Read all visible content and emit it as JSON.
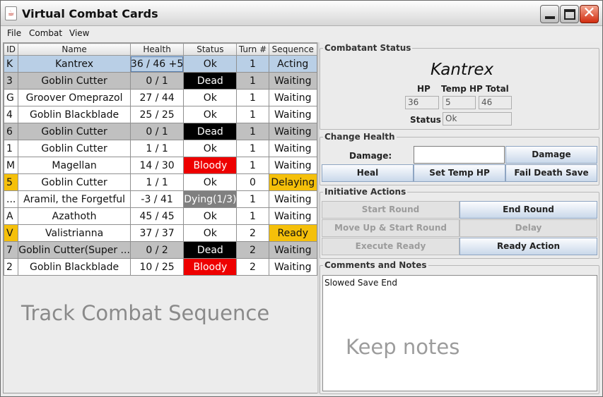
{
  "window": {
    "title": "Virtual Combat Cards"
  },
  "menu": [
    "File",
    "Combat",
    "View"
  ],
  "table": {
    "headers": {
      "id": "ID",
      "name": "Name",
      "health": "Health",
      "status": "Status",
      "turn": "Turn #",
      "sequence": "Sequence"
    },
    "rows": [
      {
        "id": "K",
        "name": "Kantrex",
        "health": "36 / 46 +5",
        "status": "Ok",
        "turn": "1",
        "sequence": "Acting"
      },
      {
        "id": "3",
        "name": "Goblin Cutter",
        "health": "0 / 1",
        "status": "Dead",
        "turn": "1",
        "sequence": "Waiting"
      },
      {
        "id": "G",
        "name": "Groover Omeprazol",
        "health": "27 / 44",
        "status": "Ok",
        "turn": "1",
        "sequence": "Waiting"
      },
      {
        "id": "4",
        "name": "Goblin Blackblade",
        "health": "25 / 25",
        "status": "Ok",
        "turn": "1",
        "sequence": "Waiting"
      },
      {
        "id": "6",
        "name": "Goblin Cutter",
        "health": "0 / 1",
        "status": "Dead",
        "turn": "1",
        "sequence": "Waiting"
      },
      {
        "id": "1",
        "name": "Goblin Cutter",
        "health": "1 / 1",
        "status": "Ok",
        "turn": "1",
        "sequence": "Waiting"
      },
      {
        "id": "M",
        "name": "Magellan",
        "health": "14 / 30",
        "status": "Bloody",
        "turn": "1",
        "sequence": "Waiting"
      },
      {
        "id": "5",
        "name": "Goblin Cutter",
        "health": "1 / 1",
        "status": "Ok",
        "turn": "0",
        "sequence": "Delaying"
      },
      {
        "id": "...",
        "name": "Aramil, the Forgetful",
        "health": "-3 / 41",
        "status": "Dying(1/3)",
        "turn": "1",
        "sequence": "Waiting"
      },
      {
        "id": "A",
        "name": "Azathoth",
        "health": "45 / 45",
        "status": "Ok",
        "turn": "1",
        "sequence": "Waiting"
      },
      {
        "id": "V",
        "name": "Valistrianna",
        "health": "37 / 37",
        "status": "Ok",
        "turn": "2",
        "sequence": "Ready"
      },
      {
        "id": "7",
        "name": "Goblin Cutter(Super ...",
        "health": "0 / 2",
        "status": "Dead",
        "turn": "2",
        "sequence": "Waiting"
      },
      {
        "id": "2",
        "name": "Goblin Blackblade",
        "health": "10 / 25",
        "status": "Bloody",
        "turn": "2",
        "sequence": "Waiting"
      }
    ]
  },
  "left_watermark": "Track Combat Sequence",
  "combatant_status": {
    "title": "Combatant Status",
    "name": "Kantrex",
    "hp_label": "HP",
    "temp_hp_label": "Temp HP",
    "total_label": "Total",
    "hp": "36",
    "temp_hp": "5",
    "total": "46",
    "status_label": "Status",
    "status": "Ok"
  },
  "change_health": {
    "title": "Change Health",
    "damage_label": "Damage:",
    "damage_value": "",
    "damage_button": "Damage",
    "heal_button": "Heal",
    "temp_hp_button": "Set Temp HP",
    "death_save_button": "Fail Death Save"
  },
  "initiative": {
    "title": "Initiative Actions",
    "start_round": "Start Round",
    "end_round": "End Round",
    "move_up": "Move Up & Start Round",
    "delay": "Delay",
    "execute_ready": "Execute Ready",
    "ready_action": "Ready Action"
  },
  "notes": {
    "title": "Comments and Notes",
    "text": "Slowed Save End",
    "watermark": "Keep notes"
  },
  "colors": {
    "dead": "#000000",
    "bloody": "#ee0000",
    "dying": "#808080",
    "highlight": "#f5c00a",
    "selected": "#b9cfe6",
    "inactive": "#c0c0c0"
  }
}
